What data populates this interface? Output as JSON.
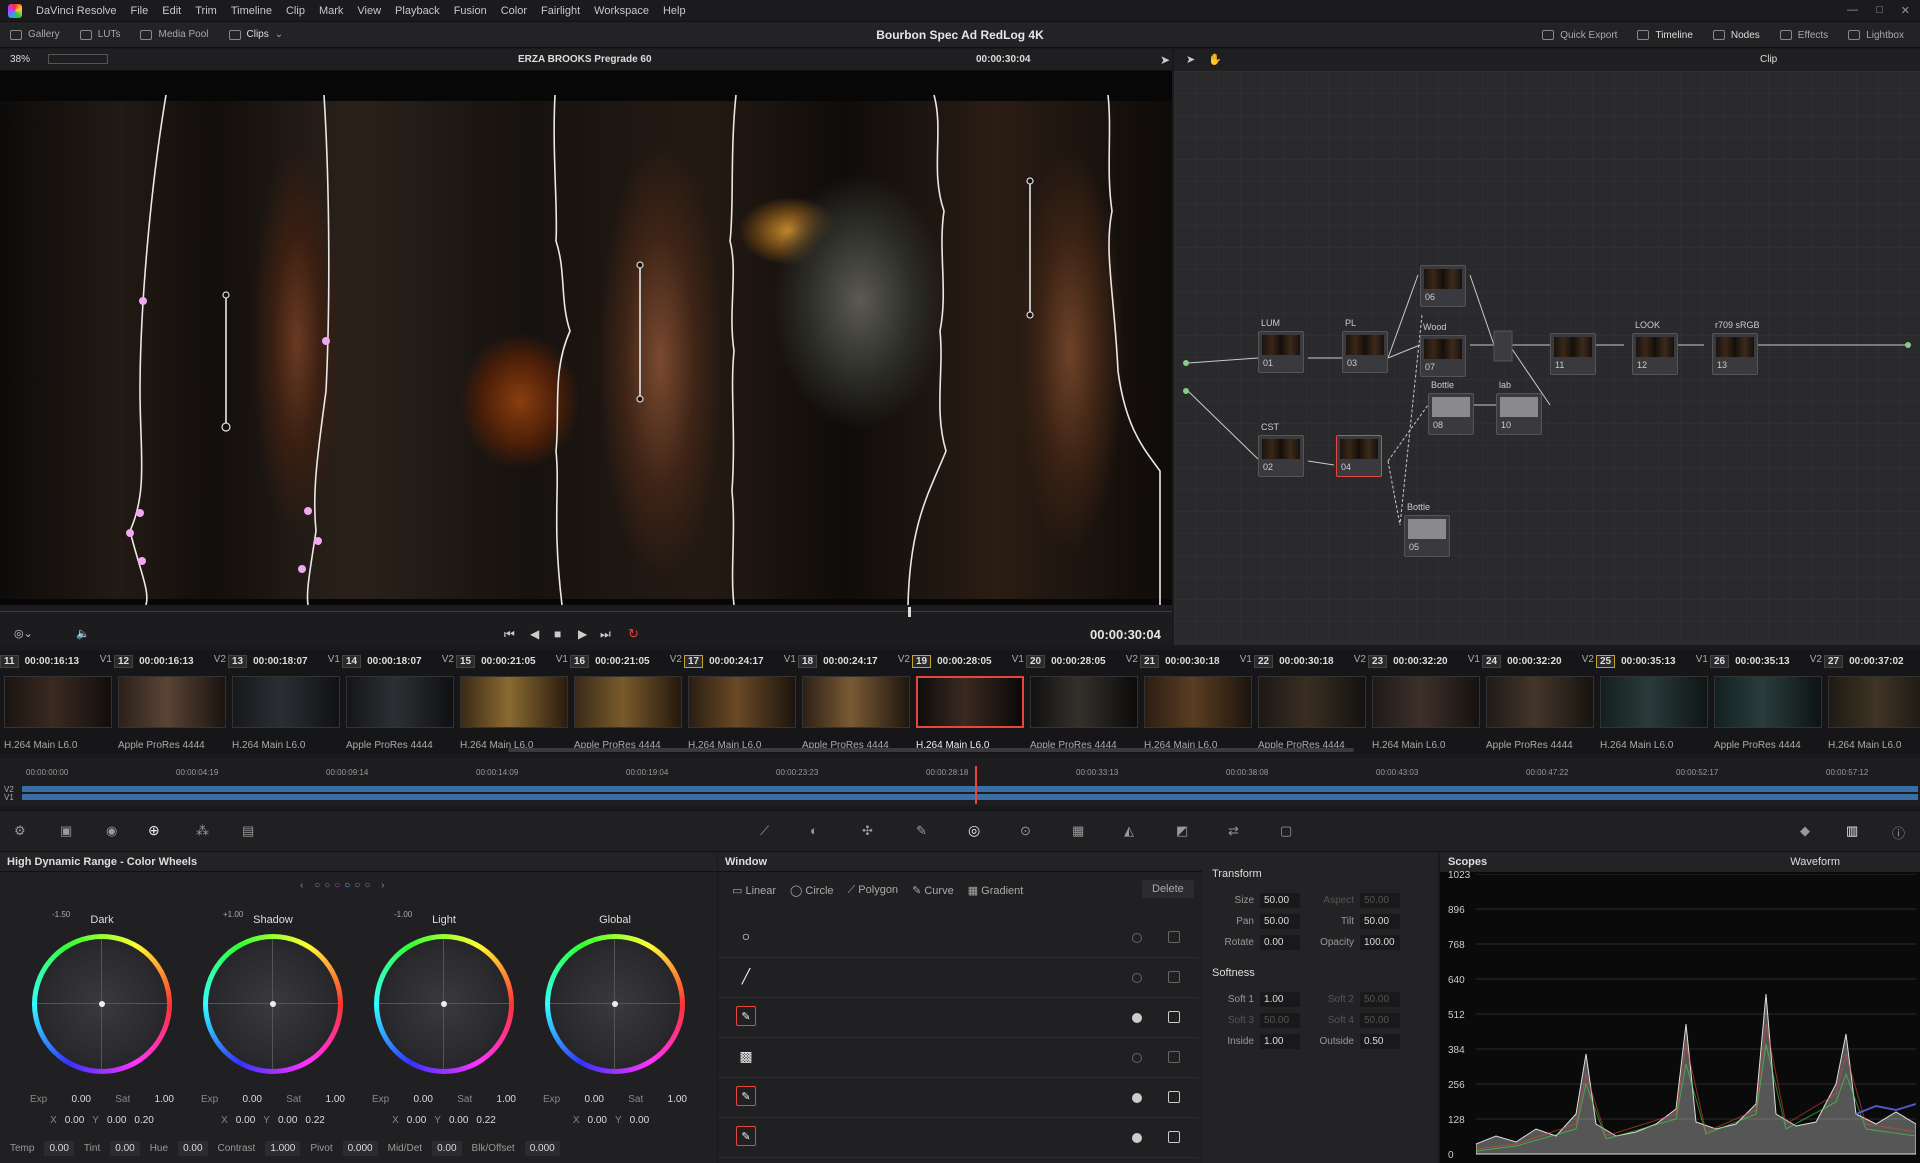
{
  "menu": {
    "app": "DaVinci Resolve",
    "items": [
      "File",
      "Edit",
      "Trim",
      "Timeline",
      "Clip",
      "Mark",
      "View",
      "Playback",
      "Fusion",
      "Color",
      "Fairlight",
      "Workspace",
      "Help"
    ]
  },
  "toolbar": {
    "left": [
      "Gallery",
      "LUTs",
      "Media Pool",
      "Clips"
    ],
    "project_title": "Bourbon Spec Ad RedLog 4K",
    "right": [
      "Quick Export",
      "Timeline",
      "Nodes",
      "Effects",
      "Lightbox"
    ]
  },
  "viewer": {
    "zoom": "38%",
    "clip_name": "ERZA BROOKS Pregrade 60",
    "timecode": "00:00:30:04",
    "transport_timecode": "00:00:30:04"
  },
  "nodes_bar": {
    "mode": "Clip"
  },
  "nodes": [
    {
      "num": "01",
      "label": "LUM"
    },
    {
      "num": "03",
      "label": "PL"
    },
    {
      "num": "06",
      "label": ""
    },
    {
      "num": "07",
      "label": "Wood"
    },
    {
      "num": "11",
      "label": ""
    },
    {
      "num": "12",
      "label": "LOOK"
    },
    {
      "num": "13",
      "label": "r709 sRGB"
    },
    {
      "num": "02",
      "label": "CST"
    },
    {
      "num": "04",
      "label": ""
    },
    {
      "num": "08",
      "label": "Bottle"
    },
    {
      "num": "10",
      "label": "lab"
    },
    {
      "num": "05",
      "label": "Bottle"
    }
  ],
  "clips": [
    {
      "num": "11",
      "tc": "00:00:16:13",
      "track": "V1",
      "codec": "H.264 Main L6.0"
    },
    {
      "num": "12",
      "tc": "00:00:16:13",
      "track": "V2",
      "codec": "Apple ProRes 4444"
    },
    {
      "num": "13",
      "tc": "00:00:18:07",
      "track": "V1",
      "codec": "H.264 Main L6.0"
    },
    {
      "num": "14",
      "tc": "00:00:18:07",
      "track": "V2",
      "codec": "Apple ProRes 4444"
    },
    {
      "num": "15",
      "tc": "00:00:21:05",
      "track": "V1",
      "codec": "H.264 Main L6.0"
    },
    {
      "num": "16",
      "tc": "00:00:21:05",
      "track": "V2",
      "codec": "Apple ProRes 4444"
    },
    {
      "num": "17",
      "tc": "00:00:24:17",
      "track": "V1",
      "codec": "H.264 Main L6.0"
    },
    {
      "num": "18",
      "tc": "00:00:24:17",
      "track": "V2",
      "codec": "Apple ProRes 4444"
    },
    {
      "num": "19",
      "tc": "00:00:28:05",
      "track": "V1",
      "codec": "H.264 Main L6.0"
    },
    {
      "num": "20",
      "tc": "00:00:28:05",
      "track": "V2",
      "codec": "Apple ProRes 4444"
    },
    {
      "num": "21",
      "tc": "00:00:30:18",
      "track": "V1",
      "codec": "H.264 Main L6.0"
    },
    {
      "num": "22",
      "tc": "00:00:30:18",
      "track": "V2",
      "codec": "Apple ProRes 4444"
    },
    {
      "num": "23",
      "tc": "00:00:32:20",
      "track": "V1",
      "codec": "H.264 Main L6.0"
    },
    {
      "num": "24",
      "tc": "00:00:32:20",
      "track": "V2",
      "codec": "Apple ProRes 4444"
    },
    {
      "num": "25",
      "tc": "00:00:35:13",
      "track": "V1",
      "codec": "H.264 Main L6.0"
    },
    {
      "num": "26",
      "tc": "00:00:35:13",
      "track": "V2",
      "codec": "Apple ProRes 4444"
    },
    {
      "num": "27",
      "tc": "00:00:37:02",
      "track": "",
      "codec": "H.264 Main L6.0"
    }
  ],
  "timeline": {
    "ticks": [
      "00:00:00:00",
      "00:00:04:19",
      "00:00:09:14",
      "00:00:14:09",
      "00:00:19:04",
      "00:00:23:23",
      "00:00:28:18",
      "00:00:33:13",
      "00:00:38:08",
      "00:00:43:03",
      "00:00:47:22",
      "00:00:52:17",
      "00:00:57:12"
    ],
    "tracks": [
      "V2",
      "V1"
    ]
  },
  "wheels": {
    "title": "High Dynamic Range - Color Wheels",
    "items": [
      {
        "name": "Dark",
        "small": "-1.50",
        "exp": "0.00",
        "sat": "1.00",
        "x": "0.00",
        "y": "0.00",
        "z": "0.20"
      },
      {
        "name": "Shadow",
        "small": "+1.00",
        "exp": "0.00",
        "sat": "1.00",
        "x": "0.00",
        "y": "0.00",
        "z": "0.22"
      },
      {
        "name": "Light",
        "small": "-1.00",
        "exp": "0.00",
        "sat": "1.00",
        "x": "0.00",
        "y": "0.00",
        "z": "0.22"
      },
      {
        "name": "Global",
        "small": "",
        "exp": "0.00",
        "sat": "1.00",
        "x": "0.00",
        "y": "0.00",
        "z": ""
      }
    ],
    "bottom": [
      {
        "label": "Temp",
        "value": "0.00"
      },
      {
        "label": "Tint",
        "value": "0.00"
      },
      {
        "label": "Hue",
        "value": "0.00"
      },
      {
        "label": "Contrast",
        "value": "1.000"
      },
      {
        "label": "Pivot",
        "value": "0.000"
      },
      {
        "label": "Mid/Det",
        "value": "0.00"
      },
      {
        "label": "Blk/Offset",
        "value": "0.000"
      }
    ]
  },
  "window": {
    "title": "Window",
    "tools": [
      "Linear",
      "Circle",
      "Polygon",
      "Curve",
      "Gradient"
    ],
    "delete": "Delete"
  },
  "transform": {
    "title": "Transform",
    "size": "50.00",
    "aspect": "50.00",
    "pan": "50.00",
    "tilt": "50.00",
    "rotate": "0.00",
    "opacity": "100.00",
    "softness_title": "Softness",
    "soft1": "1.00",
    "soft2": "50.00",
    "soft3": "50.00",
    "soft4": "50.00",
    "inside": "1.00",
    "outside": "0.50",
    "labels": {
      "size": "Size",
      "aspect": "Aspect",
      "pan": "Pan",
      "tilt": "Tilt",
      "rotate": "Rotate",
      "opacity": "Opacity",
      "soft1": "Soft 1",
      "soft2": "Soft 2",
      "soft3": "Soft 3",
      "soft4": "Soft 4",
      "inside": "Inside",
      "outside": "Outside"
    }
  },
  "scopes": {
    "title": "Scopes",
    "mode": "Waveform",
    "labels": [
      "1023",
      "896",
      "768",
      "640",
      "512",
      "384",
      "256",
      "128",
      "0"
    ]
  }
}
